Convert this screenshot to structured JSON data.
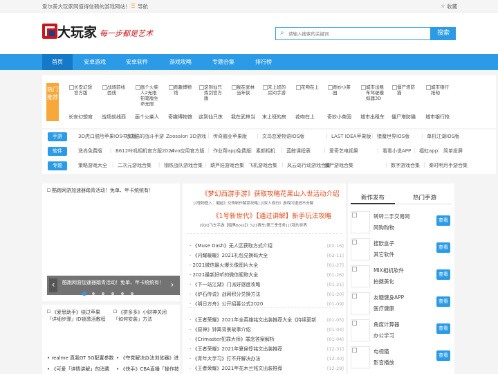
{
  "topbar": {
    "slogan": "爱尔美大玩家网值得信赖的游戏网站！",
    "nav_label": "导航",
    "fav_label": "收藏"
  },
  "header": {
    "logo_text": "大玩家",
    "logo_tagline": "每一步都是艺术",
    "search_placeholder": "请输入搜索的关键词",
    "search_button": "搜索"
  },
  "nav": {
    "items": [
      {
        "label": "首页"
      },
      {
        "label": "安卓游戏"
      },
      {
        "label": "安卓软件"
      },
      {
        "label": "游戏攻略"
      },
      {
        "label": "专题合集"
      },
      {
        "label": "排行榜"
      }
    ]
  },
  "hot": {
    "badge": "热门推荐",
    "items": [
      {
        "alt": "长安幻想官方版",
        "label": "长安幻想官"
      },
      {
        "alt": "战场前线西线",
        "label": "战场前线西"
      },
      {
        "alt": "画个火柴人2无限铅笔版生命无限",
        "label": "画个火柴人"
      },
      {
        "alt": "奇趣博物馆",
        "label": "奇趣博物馆"
      },
      {
        "alt": "这到仙只炼剑官方版",
        "label": "这到仙只炼"
      },
      {
        "alt": "我在武林当年侠",
        "label": "我在武林当"
      },
      {
        "alt": "末上班的房间手游",
        "label": "末上班的房"
      },
      {
        "alt": "花吻在上",
        "label": "花吻在上"
      },
      {
        "alt": "奇妙小茶园",
        "label": "奇妙小茶园"
      },
      {
        "alt": "城市出租车驾驶模拟器3D",
        "label": "城市出租车"
      },
      {
        "alt": "僵尸塔防猫",
        "label": "僵尸塔防猫"
      },
      {
        "alt": "城市银行抢劫",
        "label": "城市银行抢"
      }
    ]
  },
  "tags": [
    {
      "badge": "手游",
      "links": [
        "3D虎口脱险苹果IOS中文版",
        "功夫猫的战斗手游",
        "Zoosalon 3D游戏",
        "传奇霸业苹果版",
        "文鸟恋爱物语IOS版",
        "LAST IDEA苹果版",
        "猎魔世界IOS版",
        "单机江湖IOS版"
      ]
    },
    {
      "badge": "软件",
      "links": [
        "迭尚免费版",
        "B612咔叽相机官方版2024",
        "vivo应用官方版",
        "作业帮app免费版",
        "素颜相机",
        "蓝鲸课程表",
        "爱奇艺电视果",
        "看看小说APP",
        "福虹app",
        "简单投屏"
      ]
    },
    {
      "badge": "专题",
      "links": [
        "策略游戏大全",
        "二次元游戏合集",
        "钢铁战队游戏合集",
        "葫芦娃游戏合集",
        "飞机游戏合集",
        "风云岛行动游戏合集",
        "僵尸游戏合集",
        "数字游戏合集",
        "秦时明月手游合集"
      ]
    }
  ],
  "carousel": {
    "img_alt": "酷跑网游加速器踏青活动！免单、年卡统统有！",
    "caption": "酷跑网游加速器踏青活动！免单、年卡统统有！",
    "prev": "‹",
    "next": "›"
  },
  "left_promos": [
    {
      "text1": "《爱思助手》绕过苹果",
      "text2": "「详细步骤」ID锁激活教程"
    },
    {
      "text1": "《拼多多》小财神关闭",
      "text2": "「如何安装」方法"
    }
  ],
  "left_news": [
    {
      "title": "realme 真我GT 5G配置参数"
    },
    {
      "title": "《夺党解决办法浏览器》进"
    },
    {
      "title": "《可爱「详情讲解」的消费"
    },
    {
      "title": "《快手》CBA直播「操作技"
    }
  ],
  "featured": [
    {
      "title": "《梦幻西游手游》获取攻略花果山入世活动介绍",
      "sub": "[《怪物登入：崛起》交珠制作解锁攻略] [《双人成行》游戏闪退进不去解"
    },
    {
      "title": "《1号新世代》【通过讲解】新手玩法攻略",
      "sub": "[《QQ飞车手游【暗黑boss】》S21赛车]第三季任务] [《我的世界"
    }
  ],
  "news": [
    {
      "title": "《Muse Dash》无人区获取方式介绍",
      "date": "[02-16]"
    },
    {
      "title": "《闪耀暖暖》2021礼包兑换码大全",
      "date": "[02-11]"
    },
    {
      "title": "2021微信最火爆头像图片大全",
      "date": "[01-27]"
    },
    {
      "title": "2021最新好听的微信昵称大全",
      "date": "[01-26]"
    },
    {
      "title": "《下一站江湖》门派好感度攻略",
      "date": "[01-21]"
    },
    {
      "title": "《炉石传说》战网积分兑换方法",
      "date": "[01-20]"
    },
    {
      "title": "《明日方舟》公开招募公式2020",
      "date": "[01-09]"
    },
    {
      "title": "《王者荣耀》2021年全英雄铭文出装推荐大全《持续更新",
      "date": "[01-05]"
    },
    {
      "title": "《原神》钟离背景故事介绍",
      "date": "[01-04]"
    },
    {
      "title": "《Crimaster犯罪大师》罪念答案解析",
      "date": "[01-04]"
    },
    {
      "title": "《王者荣耀》2021年夏侯惇铭文出装推荐",
      "date": "[12-31]"
    },
    {
      "title": "《青年大学习》打不开解决办法",
      "date": "[12-30]"
    },
    {
      "title": "《王者荣耀》2021年花木兰铭文出装推荐",
      "date": "[12-29]"
    }
  ],
  "right": {
    "tab_new": "新作发布",
    "tab_hot": "热门手游",
    "view_label": "查看",
    "items": [
      {
        "line1": "转转二手交易网",
        "line2": "网购购物"
      },
      {
        "line1": "搜欧盒子",
        "line2": "其它软件"
      },
      {
        "line1": "MIX相机软件",
        "line2": "拍摄美化"
      },
      {
        "line1": "友糖健身APP",
        "line2": "医疗健康"
      },
      {
        "line1": "角度计算器",
        "line2": "办公学习"
      },
      {
        "line1": "电视猫",
        "line2": "影音播放"
      }
    ]
  },
  "colors": {
    "accent": "#2b9be7",
    "nav_active": "#1579c9",
    "hot_badge": "#f6a93a",
    "featured_title": "#e24a1c"
  }
}
